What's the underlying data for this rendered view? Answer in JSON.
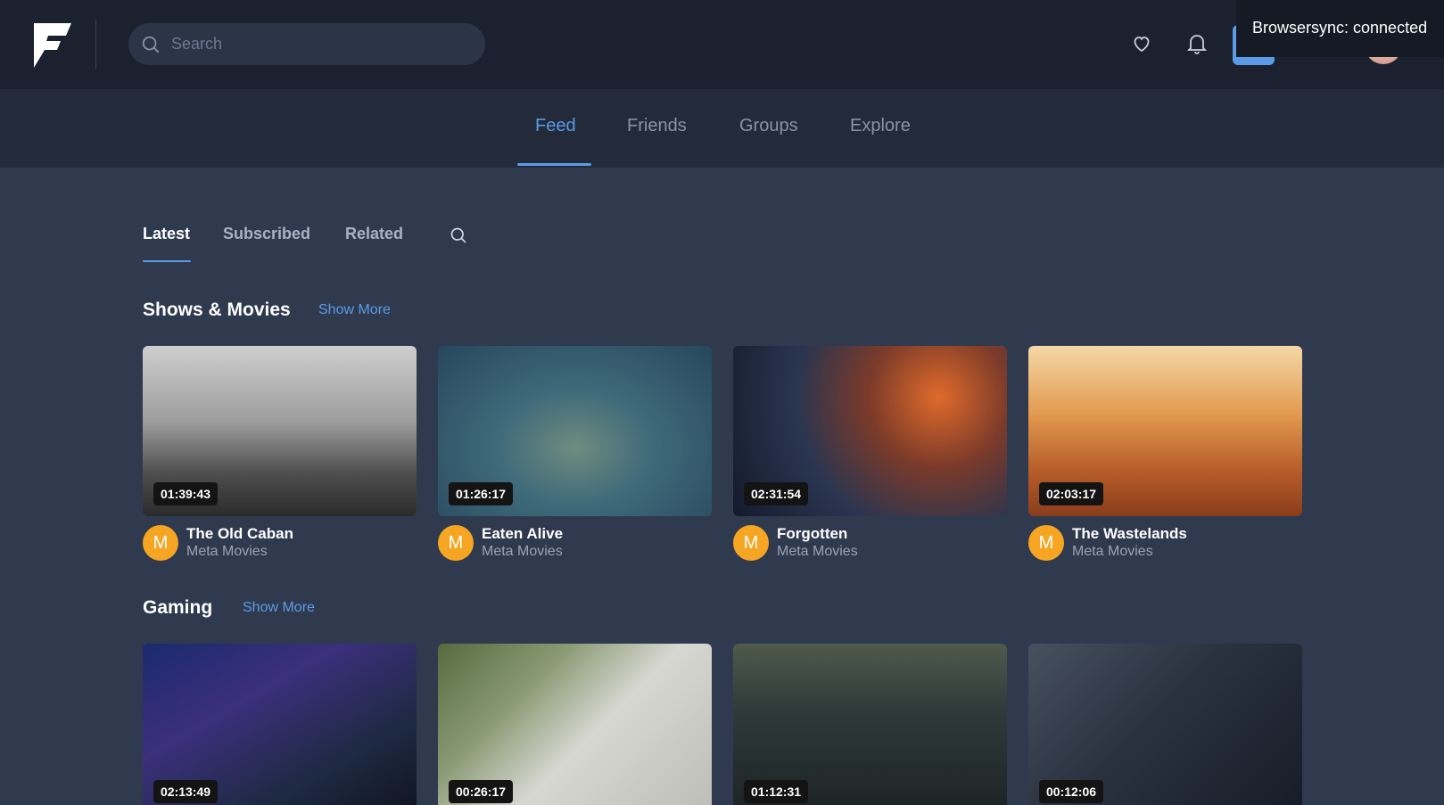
{
  "header": {
    "search_placeholder": "Search",
    "toast": "Browsersync: connected"
  },
  "main_nav": {
    "tabs": [
      {
        "label": "Feed",
        "active": true
      },
      {
        "label": "Friends",
        "active": false
      },
      {
        "label": "Groups",
        "active": false
      },
      {
        "label": "Explore",
        "active": false
      }
    ]
  },
  "sub_nav": {
    "tabs": [
      {
        "label": "Latest",
        "active": true
      },
      {
        "label": "Subscribed",
        "active": false
      },
      {
        "label": "Related",
        "active": false
      }
    ]
  },
  "sections": [
    {
      "title": "Shows & Movies",
      "show_more": "Show More",
      "cards": [
        {
          "duration": "01:39:43",
          "title": "The Old Caban",
          "channel": "Meta Movies",
          "avatar_letter": "M"
        },
        {
          "duration": "01:26:17",
          "title": "Eaten Alive",
          "channel": "Meta Movies",
          "avatar_letter": "M"
        },
        {
          "duration": "02:31:54",
          "title": "Forgotten",
          "channel": "Meta Movies",
          "avatar_letter": "M"
        },
        {
          "duration": "02:03:17",
          "title": "The Wastelands",
          "channel": "Meta Movies",
          "avatar_letter": "M"
        }
      ]
    },
    {
      "title": "Gaming",
      "show_more": "Show More",
      "cards": [
        {
          "duration": "02:13:49"
        },
        {
          "duration": "00:26:17"
        },
        {
          "duration": "01:12:31"
        },
        {
          "duration": "00:12:06"
        }
      ]
    }
  ],
  "colors": {
    "accent": "#5b9be8",
    "topbar": "#1b212e",
    "nav": "#232b3a",
    "content": "#2f3a4e",
    "channel_avatar": "#f6a623"
  }
}
